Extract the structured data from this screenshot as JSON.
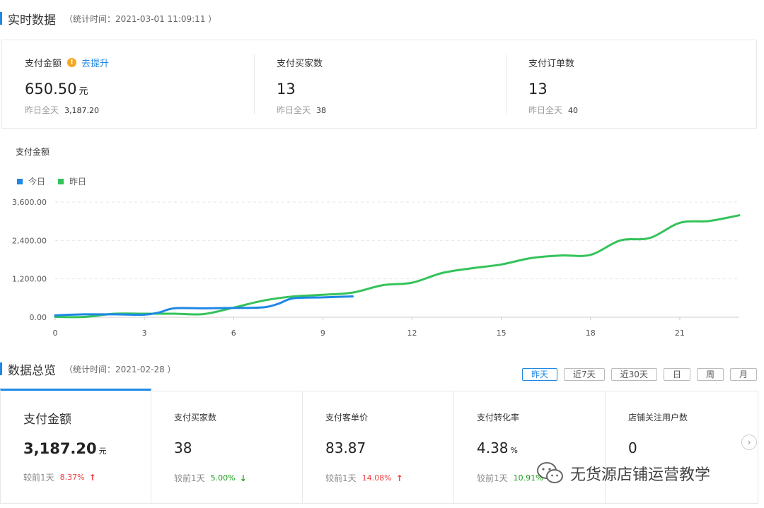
{
  "realtime": {
    "title": "实时数据",
    "stat_time": "（统计时间：2021-03-01 11:09:11 ）",
    "metrics": [
      {
        "label": "支付金额",
        "value": "650.50",
        "unit": "元",
        "yest_label": "昨日全天",
        "yest_value": "3,187.20"
      },
      {
        "label": "支付买家数",
        "value": "13",
        "unit": "",
        "yest_label": "昨日全天",
        "yest_value": "38"
      },
      {
        "label": "支付订单数",
        "value": "13",
        "unit": "",
        "yest_label": "昨日全天",
        "yest_value": "40"
      }
    ],
    "improve_link": "去提升",
    "warn_icon": "warning-icon"
  },
  "chart": {
    "title": "支付金额",
    "legend": [
      {
        "name": "今日",
        "color": "#1e88e5"
      },
      {
        "name": "昨日",
        "color": "#34c35a"
      }
    ]
  },
  "chart_data": {
    "type": "line",
    "title": "支付金额",
    "xlabel": "",
    "ylabel": "",
    "x_ticks": [
      "0",
      "3",
      "6",
      "9",
      "12",
      "15",
      "18",
      "21"
    ],
    "y_ticks": [
      "0.00",
      "1,200.00",
      "2,400.00",
      "3,600.00"
    ],
    "xlim": [
      0,
      23
    ],
    "ylim": [
      0,
      3600
    ],
    "grid": true,
    "legend_position": "top-left",
    "series": [
      {
        "name": "今日",
        "color": "#1e88e5",
        "points": [
          [
            0,
            60
          ],
          [
            1,
            90
          ],
          [
            2,
            90
          ],
          [
            3,
            80
          ],
          [
            3.5,
            150
          ],
          [
            4,
            280
          ],
          [
            5,
            280
          ],
          [
            6,
            290
          ],
          [
            7,
            310
          ],
          [
            7.5,
            420
          ],
          [
            8,
            590
          ],
          [
            9,
            620
          ],
          [
            10,
            650.5
          ]
        ]
      },
      {
        "name": "昨日",
        "color": "#34c35a",
        "points": [
          [
            0,
            10
          ],
          [
            1,
            10
          ],
          [
            2,
            110
          ],
          [
            3,
            110
          ],
          [
            4,
            110
          ],
          [
            5,
            100
          ],
          [
            6,
            300
          ],
          [
            7,
            520
          ],
          [
            8,
            650
          ],
          [
            9,
            700
          ],
          [
            10,
            770
          ],
          [
            11,
            1000
          ],
          [
            12,
            1080
          ],
          [
            13,
            1380
          ],
          [
            14,
            1530
          ],
          [
            15,
            1650
          ],
          [
            16,
            1850
          ],
          [
            17,
            1930
          ],
          [
            18,
            1950
          ],
          [
            19,
            2400
          ],
          [
            20,
            2480
          ],
          [
            21,
            2950
          ],
          [
            22,
            3010
          ],
          [
            23,
            3187.2
          ]
        ]
      }
    ]
  },
  "overview": {
    "title": "数据总览",
    "stat_time": "（统计时间：2021-02-28 ）",
    "ranges": [
      "昨天",
      "近7天",
      "近30天",
      "日",
      "周",
      "月"
    ],
    "active_range": "昨天",
    "cards": [
      {
        "label": "支付金额",
        "value": "3,187.20",
        "unit": "元",
        "cmp_label": "较前1天",
        "pct": "8.37%",
        "trend": "up"
      },
      {
        "label": "支付买家数",
        "value": "38",
        "unit": "",
        "cmp_label": "较前1天",
        "pct": "5.00%",
        "trend": "down"
      },
      {
        "label": "支付客单价",
        "value": "83.87",
        "unit": "",
        "cmp_label": "较前1天",
        "pct": "14.08%",
        "trend": "up"
      },
      {
        "label": "支付转化率",
        "value": "4.38",
        "unit": "%",
        "cmp_label": "较前1天",
        "pct": "10.91%",
        "trend": "up"
      },
      {
        "label": "店铺关注用户数",
        "value": "0",
        "unit": "",
        "cmp_label": "",
        "pct": "",
        "trend": ""
      }
    ],
    "up_arrow": "↑",
    "down_arrow": "↓",
    "next_icon": "chevron-right-icon"
  },
  "watermark": {
    "text": "无货源店铺运营教学",
    "icon": "wechat-icon"
  }
}
